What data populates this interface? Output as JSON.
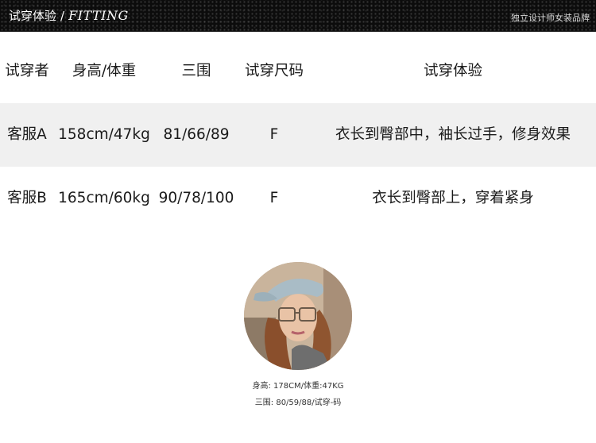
{
  "header": {
    "title_cn": "试穿体验",
    "separator": "/",
    "title_en": "FITTING",
    "brand": "独立设计师女装品牌"
  },
  "table": {
    "headers": [
      "试穿者",
      "身高/体重",
      "三围",
      "试穿尺码",
      "试穿体验"
    ],
    "rows": [
      [
        "客服A",
        "158cm/47kg",
        "81/66/89",
        "F",
        "衣长到臀部中，袖长过手，修身效果"
      ],
      [
        "客服B",
        "165cm/60kg",
        "90/78/100",
        "F",
        "衣长到臀部上，穿着紧身"
      ]
    ]
  },
  "model": {
    "line1": "身高: 178CM/体重:47KG",
    "line2": "三围: 80/59/88/试穿-码"
  },
  "colors": {
    "header_bg": "#0c0c0c",
    "row_shade": "#f0f0f0",
    "text": "#1a1a1a"
  }
}
